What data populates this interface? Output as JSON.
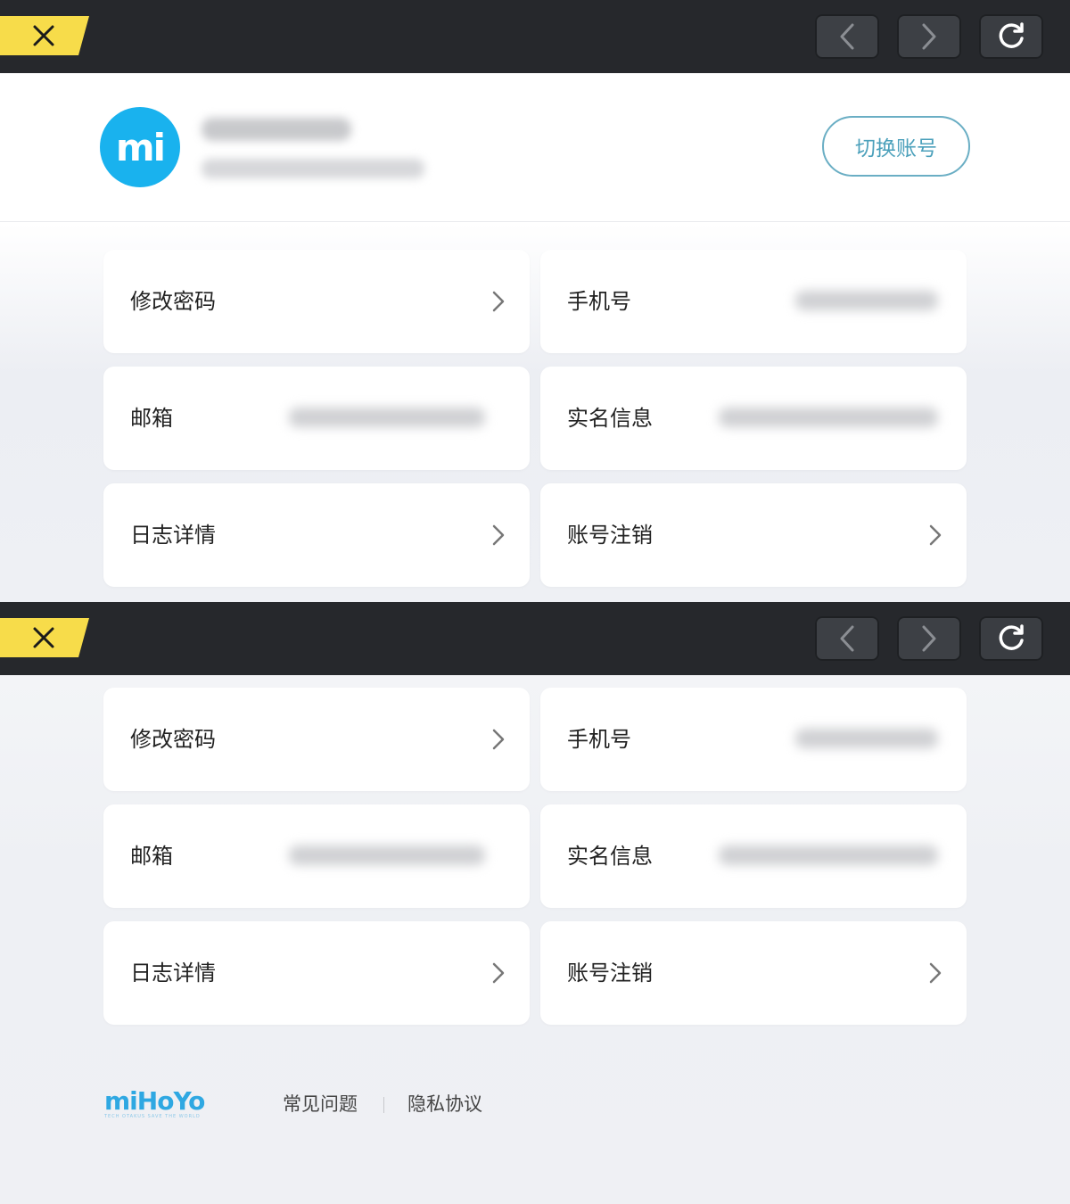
{
  "profile": {
    "avatar_text": "mi",
    "switch_account_label": "切换账号"
  },
  "menu": {
    "change_password": "修改密码",
    "phone": "手机号",
    "email": "邮箱",
    "real_name": "实名信息",
    "log_details": "日志详情",
    "delete_account": "账号注销"
  },
  "footer": {
    "logo_text": "miHoYo",
    "logo_tagline": "TECH OTAKUS SAVE THE WORLD",
    "faq": "常见问题",
    "privacy": "隐私协议"
  },
  "colors": {
    "topbar": "#26282c",
    "close_tab": "#f7dc4a",
    "avatar": "#19b2ee",
    "switch_border": "#6aaec4",
    "brand": "#2fa8e2"
  }
}
